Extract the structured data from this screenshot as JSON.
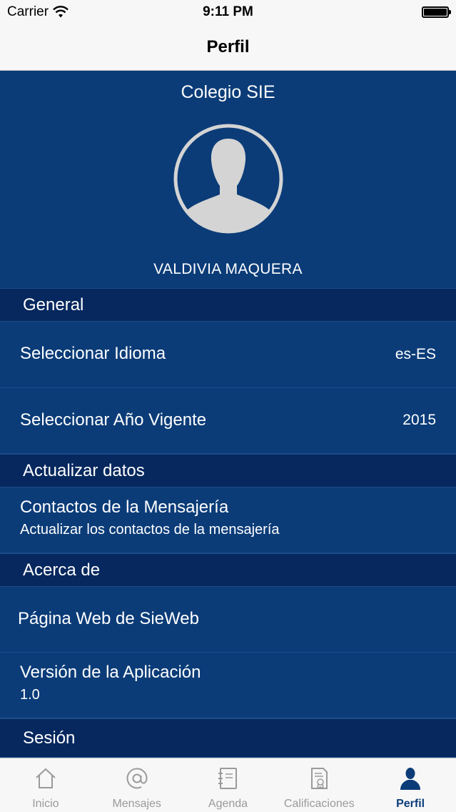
{
  "status_bar": {
    "carrier": "Carrier",
    "time": "9:11 PM"
  },
  "nav": {
    "title": "Perfil"
  },
  "profile": {
    "school": "Colegio SIE",
    "user_name": "VALDIVIA MAQUERA"
  },
  "sections": {
    "general": {
      "header": "General",
      "language_label": "Seleccionar Idioma",
      "language_value": "es-ES",
      "year_label": "Seleccionar Año Vigente",
      "year_value": "2015"
    },
    "update": {
      "header": "Actualizar datos",
      "contacts_title": "Contactos de la Mensajería",
      "contacts_subtitle": "Actualizar los contactos de la mensajería"
    },
    "about": {
      "header": "Acerca de",
      "website_label": "Página Web de SieWeb",
      "version_label": "Versión de la Aplicación",
      "version_value": "1.0"
    },
    "session": {
      "header": "Sesión"
    }
  },
  "tabs": [
    {
      "label": "Inicio",
      "icon": "home-icon"
    },
    {
      "label": "Mensajes",
      "icon": "at-sign-icon"
    },
    {
      "label": "Agenda",
      "icon": "notebook-icon"
    },
    {
      "label": "Calificaciones",
      "icon": "certificate-icon"
    },
    {
      "label": "Perfil",
      "icon": "person-icon",
      "active": true
    }
  ],
  "colors": {
    "primary": "#0b3c78",
    "section": "#06285e",
    "tab_active": "#0b3c78",
    "tab_inactive": "#9a9a9a"
  }
}
